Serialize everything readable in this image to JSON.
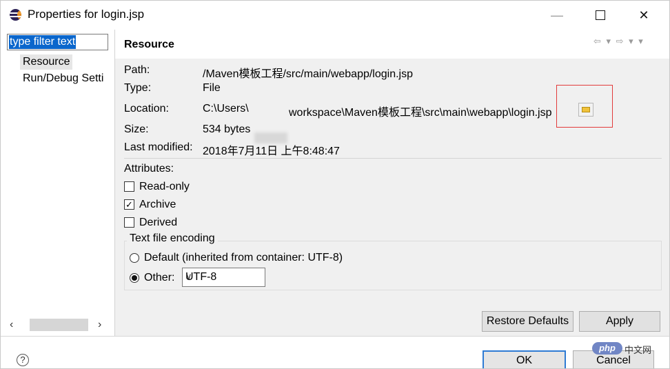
{
  "window": {
    "title": "Properties for login.jsp"
  },
  "left": {
    "filter_text": "type filter text",
    "tree": [
      {
        "label": "Resource"
      },
      {
        "label": "Run/Debug Setti"
      }
    ]
  },
  "page": {
    "title": "Resource",
    "nav_glyphs": "⇦ ▾ ⇨ ▾ ▾",
    "fields": {
      "path_label": "Path:",
      "path_value": "/Maven模板工程/src/main/webapp/login.jsp",
      "type_label": "Type:",
      "type_value": "File",
      "location_label": "Location:",
      "location_prefix": "C:\\Users\\",
      "location_suffix": "workspace\\Maven模板工程\\src\\main\\webapp\\login.jsp",
      "size_label": "Size:",
      "size_value": "534  bytes",
      "modified_label": "Last modified:",
      "modified_value": "2018年7月11日 上午8:48:47"
    },
    "attributes": {
      "label": "Attributes:",
      "readonly": "Read-only",
      "archive": "Archive",
      "derived": "Derived"
    },
    "encoding": {
      "label": "Text file encoding",
      "default_option": "Default (inherited from container: UTF-8)",
      "other_option": "Other:",
      "value": "UTF-8"
    },
    "buttons": {
      "restore": "Restore Defaults",
      "apply": "Apply"
    }
  },
  "footer": {
    "ok": "OK",
    "cancel": "Cancel"
  },
  "watermark": {
    "brand": "php",
    "text": "中文网"
  }
}
